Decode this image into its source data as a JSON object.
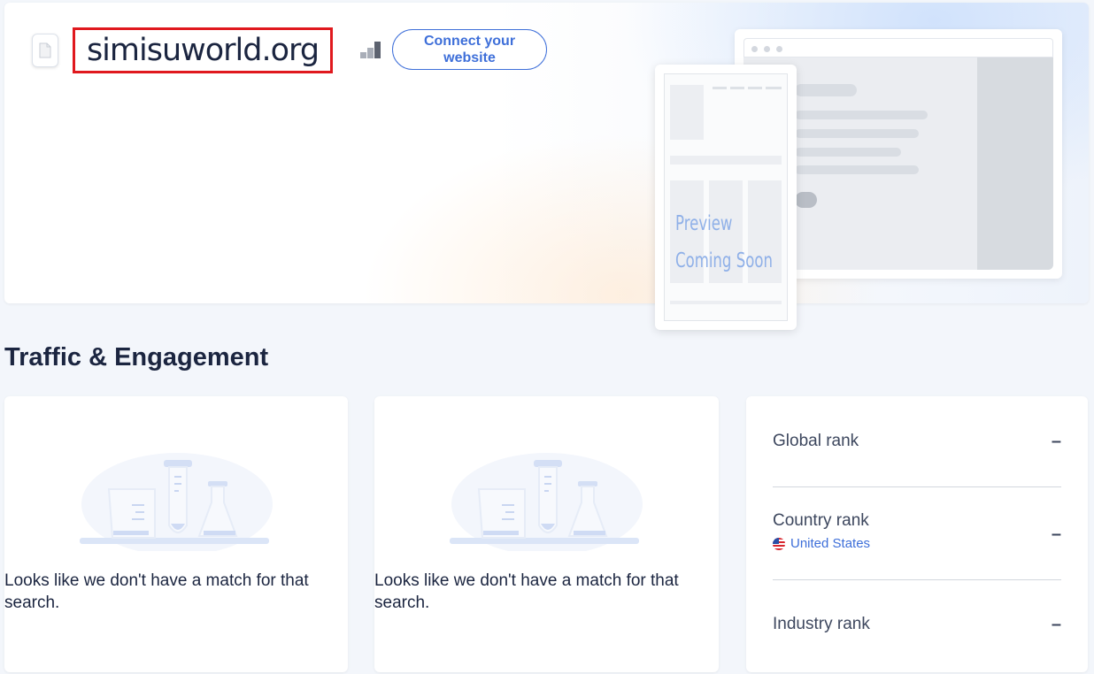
{
  "header": {
    "site_name": "simisuworld.org",
    "connect_button": "Connect your website",
    "preview_line1": "Preview",
    "preview_line2": "Coming Soon"
  },
  "section": {
    "title": "Traffic & Engagement"
  },
  "cards": [
    {
      "message": "Looks like we don't have a match for that search."
    },
    {
      "message": "Looks like we don't have a match for that search."
    }
  ],
  "ranks": {
    "global_label": "Global rank",
    "global_value": "–",
    "country_label": "Country rank",
    "country_name": "United States",
    "country_value": "–",
    "industry_label": "Industry rank",
    "industry_value": "–"
  },
  "colors": {
    "accent": "#3e6fd9",
    "highlight_box": "#e0191e",
    "text": "#1b2540"
  },
  "icons": [
    "file-icon",
    "rank-bars-icon",
    "us-flag-icon",
    "lab-empty-state-icon"
  ]
}
